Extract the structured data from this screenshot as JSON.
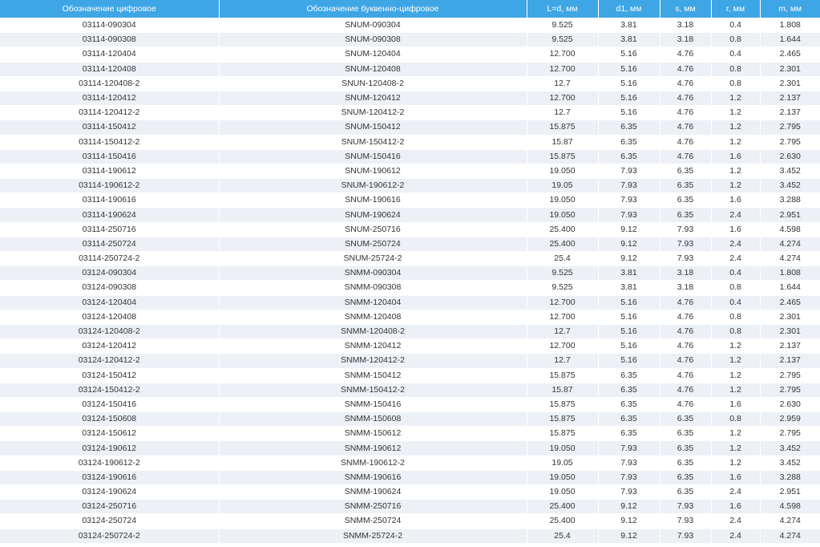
{
  "table": {
    "headers": [
      "Обозначение цифровое",
      "Обозначение буквенно-цифровое",
      "L=d, мм",
      "d1, мм",
      "s, мм",
      "r, мм",
      "m, мм"
    ],
    "rows": [
      [
        "03114-090304",
        "SNUM-090304",
        "9.525",
        "3.81",
        "3.18",
        "0.4",
        "1.808"
      ],
      [
        "03114-090308",
        "SNUM-090308",
        "9.525",
        "3.81",
        "3.18",
        "0.8",
        "1.644"
      ],
      [
        "03114-120404",
        "SNUM-120404",
        "12.700",
        "5.16",
        "4.76",
        "0.4",
        "2.465"
      ],
      [
        "03114-120408",
        "SNUM-120408",
        "12.700",
        "5.16",
        "4.76",
        "0.8",
        "2.301"
      ],
      [
        "03114-120408-2",
        "SNUN-120408-2",
        "12.7",
        "5.16",
        "4.76",
        "0.8",
        "2.301"
      ],
      [
        "03114-120412",
        "SNUM-120412",
        "12.700",
        "5.16",
        "4.76",
        "1.2",
        "2.137"
      ],
      [
        "03114-120412-2",
        "SNUM-120412-2",
        "12.7",
        "5.16",
        "4.76",
        "1.2",
        "2.137"
      ],
      [
        "03114-150412",
        "SNUM-150412",
        "15.875",
        "6.35",
        "4.76",
        "1.2",
        "2.795"
      ],
      [
        "03114-150412-2",
        "SNUM-150412-2",
        "15.87",
        "6.35",
        "4.76",
        "1.2",
        "2.795"
      ],
      [
        "03114-150416",
        "SNUM-150416",
        "15.875",
        "6.35",
        "4.76",
        "1.6",
        "2.630"
      ],
      [
        "03114-190612",
        "SNUM-190612",
        "19.050",
        "7.93",
        "6.35",
        "1.2",
        "3.452"
      ],
      [
        "03114-190612-2",
        "SNUM-190612-2",
        "19.05",
        "7.93",
        "6.35",
        "1.2",
        "3.452"
      ],
      [
        "03114-190616",
        "SNUM-190616",
        "19.050",
        "7.93",
        "6.35",
        "1.6",
        "3.288"
      ],
      [
        "03114-190624",
        "SNUM-190624",
        "19.050",
        "7.93",
        "6.35",
        "2.4",
        "2.951"
      ],
      [
        "03114-250716",
        "SNUM-250716",
        "25.400",
        "9.12",
        "7.93",
        "1.6",
        "4.598"
      ],
      [
        "03114-250724",
        "SNUM-250724",
        "25.400",
        "9.12",
        "7.93",
        "2.4",
        "4.274"
      ],
      [
        "03114-250724-2",
        "SNUM-25724-2",
        "25.4",
        "9.12",
        "7.93",
        "2.4",
        "4.274"
      ],
      [
        "03124-090304",
        "SNMM-090304",
        "9.525",
        "3.81",
        "3.18",
        "0.4",
        "1.808"
      ],
      [
        "03124-090308",
        "SNMM-090308",
        "9.525",
        "3.81",
        "3.18",
        "0.8",
        "1.644"
      ],
      [
        "03124-120404",
        "SNMM-120404",
        "12.700",
        "5.16",
        "4.76",
        "0.4",
        "2.465"
      ],
      [
        "03124-120408",
        "SNMM-120408",
        "12.700",
        "5.16",
        "4.76",
        "0.8",
        "2.301"
      ],
      [
        "03124-120408-2",
        "SNMM-120408-2",
        "12.7",
        "5.16",
        "4.76",
        "0.8",
        "2.301"
      ],
      [
        "03124-120412",
        "SNMM-120412",
        "12.700",
        "5.16",
        "4.76",
        "1.2",
        "2.137"
      ],
      [
        "03124-120412-2",
        "SNMM-120412-2",
        "12.7",
        "5.16",
        "4.76",
        "1.2",
        "2.137"
      ],
      [
        "03124-150412",
        "SNMM-150412",
        "15.875",
        "6.35",
        "4.76",
        "1.2",
        "2.795"
      ],
      [
        "03124-150412-2",
        "SNMM-150412-2",
        "15.87",
        "6.35",
        "4.76",
        "1.2",
        "2.795"
      ],
      [
        "03124-150416",
        "SNMM-150416",
        "15.875",
        "6.35",
        "4.76",
        "1.6",
        "2.630"
      ],
      [
        "03124-150608",
        "SNMM-150608",
        "15.875",
        "6.35",
        "6.35",
        "0.8",
        "2.959"
      ],
      [
        "03124-150612",
        "SNMM-150612",
        "15.875",
        "6.35",
        "6.35",
        "1.2",
        "2.795"
      ],
      [
        "03124-190612",
        "SNMM-190612",
        "19.050",
        "7.93",
        "6.35",
        "1.2",
        "3.452"
      ],
      [
        "03124-190612-2",
        "SNMM-190612-2",
        "19.05",
        "7.93",
        "6.35",
        "1.2",
        "3.452"
      ],
      [
        "03124-190616",
        "SNMM-190616",
        "19.050",
        "7.93",
        "6.35",
        "1.6",
        "3.288"
      ],
      [
        "03124-190624",
        "SNMM-190624",
        "19.050",
        "7.93",
        "6.35",
        "2.4",
        "2.951"
      ],
      [
        "03124-250716",
        "SNMM-250716",
        "25.400",
        "9.12",
        "7.93",
        "1.6",
        "4.598"
      ],
      [
        "03124-250724",
        "SNMM-250724",
        "25.400",
        "9.12",
        "7.93",
        "2.4",
        "4.274"
      ],
      [
        "03124-250724-2",
        "SNMM-25724-2",
        "25.4",
        "9.12",
        "7.93",
        "2.4",
        "4.274"
      ]
    ]
  },
  "colors": {
    "header_bg": "#3fa6e6",
    "header_text": "#ffffff",
    "row_alt_bg": "#edf1f6",
    "text": "#333333"
  }
}
